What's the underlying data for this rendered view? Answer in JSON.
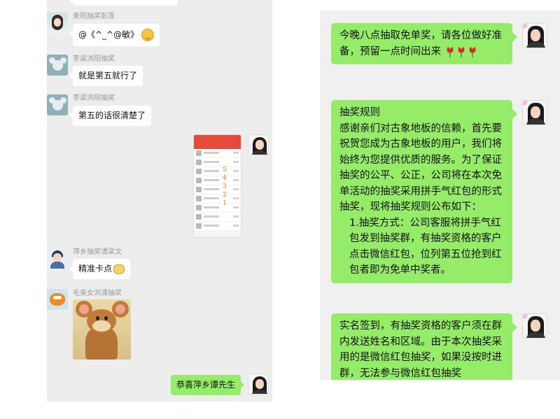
{
  "left_chat": {
    "messages": [
      {
        "sender": "耒阳抽奖彭莲",
        "text": "@《^_^@敏》"
      },
      {
        "sender": "李梁浏阳抽奖",
        "text": "就是第五就行了"
      },
      {
        "sender": "李梁浏阳抽奖",
        "text": "第五的话很清楚了"
      },
      {
        "sender": "萍乡抽奖谭梁文",
        "text": "精准卡点"
      },
      {
        "sender": "毛美女浏浦抽奖",
        "text": ""
      },
      {
        "sender": "",
        "text": "恭喜萍乡谭先生"
      }
    ],
    "screenshot_annotation": [
      "5",
      "4",
      "3",
      "2",
      "1"
    ]
  },
  "right_chat": {
    "msg1": "今晚八点抽取免单奖，请各位做好准备，预留一点时间出来",
    "msg2": {
      "title": "抽奖规则",
      "body": "感谢亲们对古象地板的信赖，首先要祝贺您成为古象地板的用户，我们将始终为您提供优质的服务。为了保证抽奖的公平、公正，公司将在本次免单活动的抽奖采用拼手气红包的形式抽奖，现将抽奖规则公布如下：",
      "item1": "1.抽奖方式：公司客服将拼手气红包发到抽奖群，有抽奖资格的客户点击微信红包，位列第五位抢到红包者即为免单中奖者。"
    },
    "msg3": "实名签到，有抽奖资格的客户须在群内发送姓名和区域。由于本次抽奖采用的是微信红包抽奖，如果没按时进群，无法参与微信红包抽奖"
  },
  "icons": {
    "emoji_smile": "smile-emoji-icon",
    "emoji_cat": "cat-emoji-icon",
    "tulip": "tulip-icon"
  },
  "colors": {
    "my_bubble": "#95ec69",
    "other_bubble": "#ffffff",
    "chat_background": "#ededed",
    "red_packet_header": "#e64a3b",
    "annotation": "#e5761e"
  }
}
